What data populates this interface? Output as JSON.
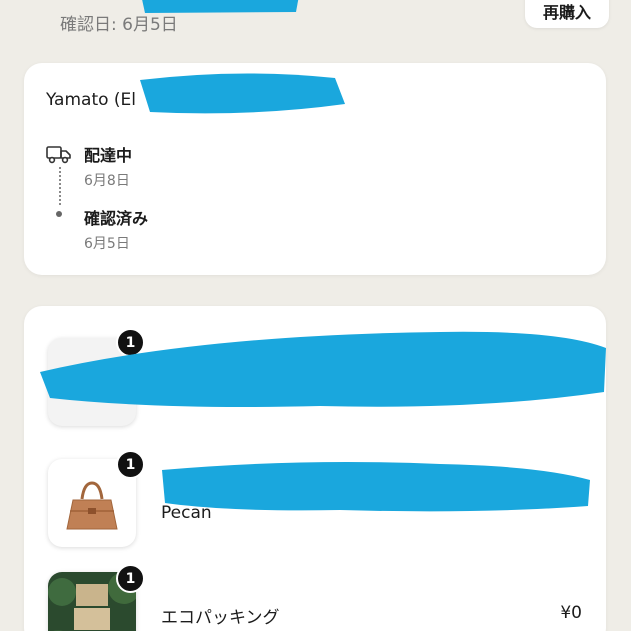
{
  "order": {
    "confirmed_label": "確認日: 6月5日",
    "rebuy_label": "再購入"
  },
  "tracking": {
    "carrier": "Yamato (El",
    "events": [
      {
        "title": "配達中",
        "date": "6月8日"
      },
      {
        "title": "確認済み",
        "date": "6月5日"
      }
    ]
  },
  "items": [
    {
      "quantity": "1",
      "variant": "",
      "name": "",
      "price": ""
    },
    {
      "quantity": "1",
      "variant": "Pecan",
      "name": "",
      "price": ""
    },
    {
      "quantity": "1",
      "variant": "",
      "name": "エコパッキング",
      "price": "¥0"
    }
  ],
  "icons": {
    "delivery": "truck-icon"
  },
  "colors": {
    "background": "#efede7",
    "card": "#ffffff",
    "badge": "#111111",
    "secondary_text": "#7a7a7a",
    "redaction": "#1aa7dd"
  }
}
